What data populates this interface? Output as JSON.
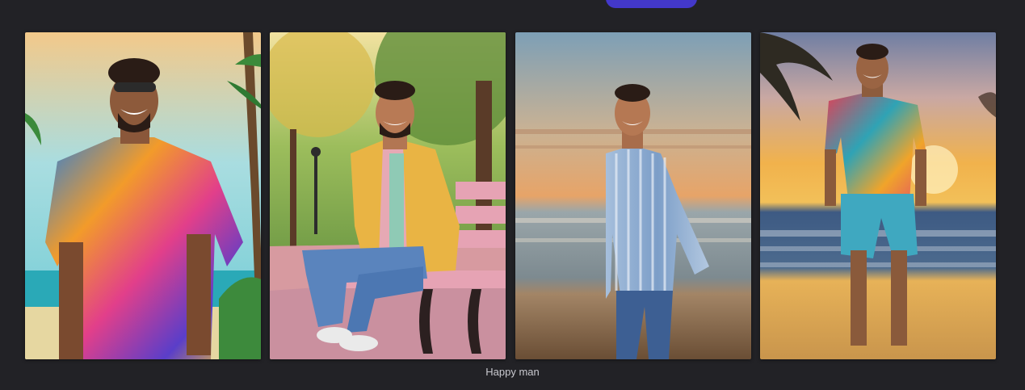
{
  "caption": "Happy man",
  "colors": {
    "background": "#222226",
    "accent": "#4338ca",
    "caption_text": "#c9c9cf"
  },
  "images": [
    {
      "name": "illustrated-man-hawaiian-shirt"
    },
    {
      "name": "man-yellow-jacket-park-bench"
    },
    {
      "name": "man-striped-shirt-beach-sunset"
    },
    {
      "name": "man-hawaiian-outfit-beach-sunset"
    }
  ]
}
